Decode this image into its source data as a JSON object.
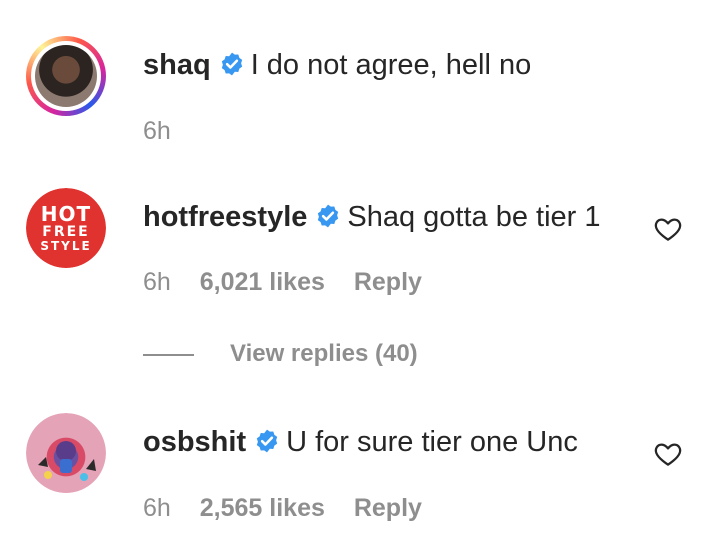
{
  "comments": [
    {
      "username": "shaq",
      "verified": true,
      "text": "I do not agree, hell no",
      "time": "6h",
      "likes": "",
      "reply": ""
    },
    {
      "username": "hotfreestyle",
      "verified": true,
      "text": "Shaq gotta be tier 1",
      "time": "6h",
      "likes": "6,021 likes",
      "reply": "Reply",
      "avatar_text": [
        "HOT",
        "FREE",
        "STYLE"
      ],
      "view_replies": "View replies (40)"
    },
    {
      "username": "osbshit",
      "verified": true,
      "text": "U for sure tier one Unc",
      "time": "6h",
      "likes": "2,565 likes",
      "reply": "Reply"
    }
  ],
  "colors": {
    "verified_badge": "#3897f0",
    "secondary_text": "#8e8e8e",
    "primary_text": "#262626",
    "hotfreestyle_brand": "#e0322e"
  },
  "icons": [
    "verified-badge-icon",
    "heart-outline-icon"
  ]
}
